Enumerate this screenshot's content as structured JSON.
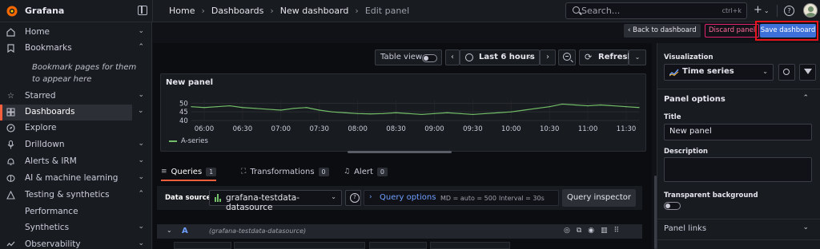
{
  "app": {
    "brand": "Grafana"
  },
  "breadcrumb": [
    "Home",
    "Dashboards",
    "New dashboard",
    "Edit panel"
  ],
  "search": {
    "placeholder": "Search...",
    "shortcut": "ctrl+k"
  },
  "topbar": {
    "new_label": "+",
    "new_chevron": "⌄",
    "help": "?"
  },
  "sidebar": {
    "items": [
      {
        "label": "Home",
        "icon": "home-icon",
        "expandable": true
      },
      {
        "label": "Bookmarks",
        "icon": "bookmark-icon",
        "expandable": true
      },
      {
        "label": "Starred",
        "icon": "star-icon",
        "expandable": true
      },
      {
        "label": "Dashboards",
        "icon": "dashboards-icon",
        "expandable": true,
        "active": true
      },
      {
        "label": "Explore",
        "icon": "explore-icon",
        "expandable": false
      },
      {
        "label": "Drilldown",
        "icon": "drilldown-icon",
        "expandable": true
      },
      {
        "label": "Alerts & IRM",
        "icon": "bell-icon",
        "expandable": true
      },
      {
        "label": "AI & machine learning",
        "icon": "brain-icon",
        "expandable": true
      },
      {
        "label": "Testing & synthetics",
        "icon": "testing-icon",
        "expandable": true
      },
      {
        "label": "Performance",
        "icon": "",
        "expandable": false
      },
      {
        "label": "Synthetics",
        "icon": "",
        "expandable": true
      },
      {
        "label": "Observability",
        "icon": "observability-icon",
        "expandable": true
      }
    ],
    "bookmark_note": "Bookmark pages for them to appear here"
  },
  "actions": {
    "back": "Back to dashboard",
    "discard": "Discard panel",
    "save": "Save dashboard"
  },
  "viz_toolbar": {
    "table_view": "Table view",
    "time_range": "Last 6 hours",
    "refresh": "Refresh"
  },
  "panel": {
    "title": "New panel",
    "legend": "A-series"
  },
  "chart_data": {
    "type": "line",
    "title": "New panel",
    "x_ticks": [
      "06:00",
      "06:30",
      "07:00",
      "07:30",
      "08:00",
      "08:30",
      "09:00",
      "09:30",
      "10:00",
      "10:30",
      "11:00",
      "11:30"
    ],
    "y_ticks": [
      40,
      45,
      50
    ],
    "ylim": [
      40,
      52
    ],
    "series": [
      {
        "name": "A-series",
        "color": "#73bf69",
        "x": [
          "05:50",
          "06:00",
          "06:10",
          "06:20",
          "06:30",
          "06:40",
          "06:50",
          "07:00",
          "07:10",
          "07:20",
          "07:30",
          "07:40",
          "07:50",
          "08:00",
          "08:10",
          "08:20",
          "08:30",
          "08:40",
          "08:50",
          "09:00",
          "09:10",
          "09:20",
          "09:30",
          "09:40",
          "09:50",
          "10:00",
          "10:10",
          "10:20",
          "10:30",
          "10:40",
          "10:50",
          "11:00",
          "11:10",
          "11:20",
          "11:30",
          "11:40"
        ],
        "values": [
          48,
          47.5,
          48,
          48.5,
          47.5,
          47,
          46.5,
          46,
          47,
          47.5,
          46,
          45,
          44.5,
          44,
          43.8,
          44,
          44.5,
          44,
          43.5,
          44,
          44.5,
          44,
          43.5,
          44,
          44.5,
          45,
          46,
          47,
          48,
          49.5,
          49,
          48.5,
          49,
          48.5,
          48,
          47.5
        ]
      }
    ]
  },
  "tabs": [
    {
      "label": "Queries",
      "count": "1",
      "icon": "database-icon",
      "active": true
    },
    {
      "label": "Transformations",
      "count": "0",
      "icon": "transform-icon",
      "active": false
    },
    {
      "label": "Alert",
      "count": "0",
      "icon": "bell-icon",
      "active": false
    }
  ],
  "query": {
    "data_source_label": "Data source",
    "data_source": "grafana-testdata-datasource",
    "options_label": "Query options",
    "md": "MD = auto = 500",
    "interval": "Interval = 30s",
    "inspector": "Query inspector",
    "ref_id": "A",
    "ref_ds": "(grafana-testdata-datasource)"
  },
  "options_pane": {
    "visualization_label": "Visualization",
    "visualization": "Time series",
    "panel_options": "Panel options",
    "title_label": "Title",
    "title_value": "New panel",
    "description_label": "Description",
    "transparent_label": "Transparent background",
    "panel_links": "Panel links"
  }
}
